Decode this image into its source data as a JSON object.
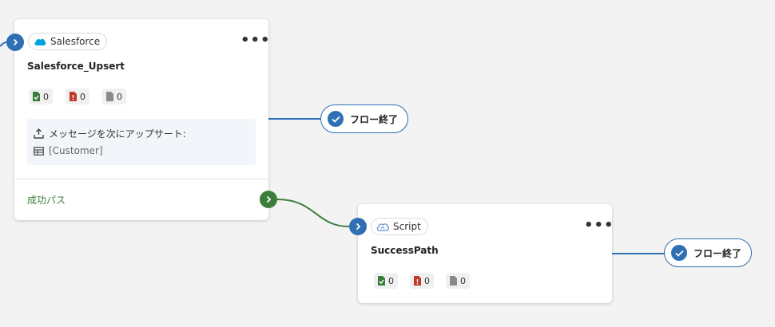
{
  "colors": {
    "canvas": "#f3f3f3",
    "accent_blue": "#2e70b3",
    "success_green": "#3b7d3b",
    "salesforce_blue": "#00a1e0",
    "doc_green": "#3b7d3b",
    "doc_red": "#c0392b",
    "doc_gray": "#8a8a8a"
  },
  "node1": {
    "connector": "Salesforce",
    "connector_icon": "salesforce-cloud-icon",
    "menu_label": "•••",
    "title": "Salesforce_Upsert",
    "stats": {
      "success": "0",
      "error": "0",
      "total": "0"
    },
    "message_label": "メッセージを次にアップサート:",
    "message_target": "[Customer]",
    "success_path": "成功パス"
  },
  "node2": {
    "connector": "Script",
    "connector_icon": "script-icon",
    "menu_label": "•••",
    "title": "SuccessPath",
    "stats": {
      "success": "0",
      "error": "0",
      "total": "0"
    }
  },
  "flow_end_1": "フロー終了",
  "flow_end_2": "フロー終了"
}
